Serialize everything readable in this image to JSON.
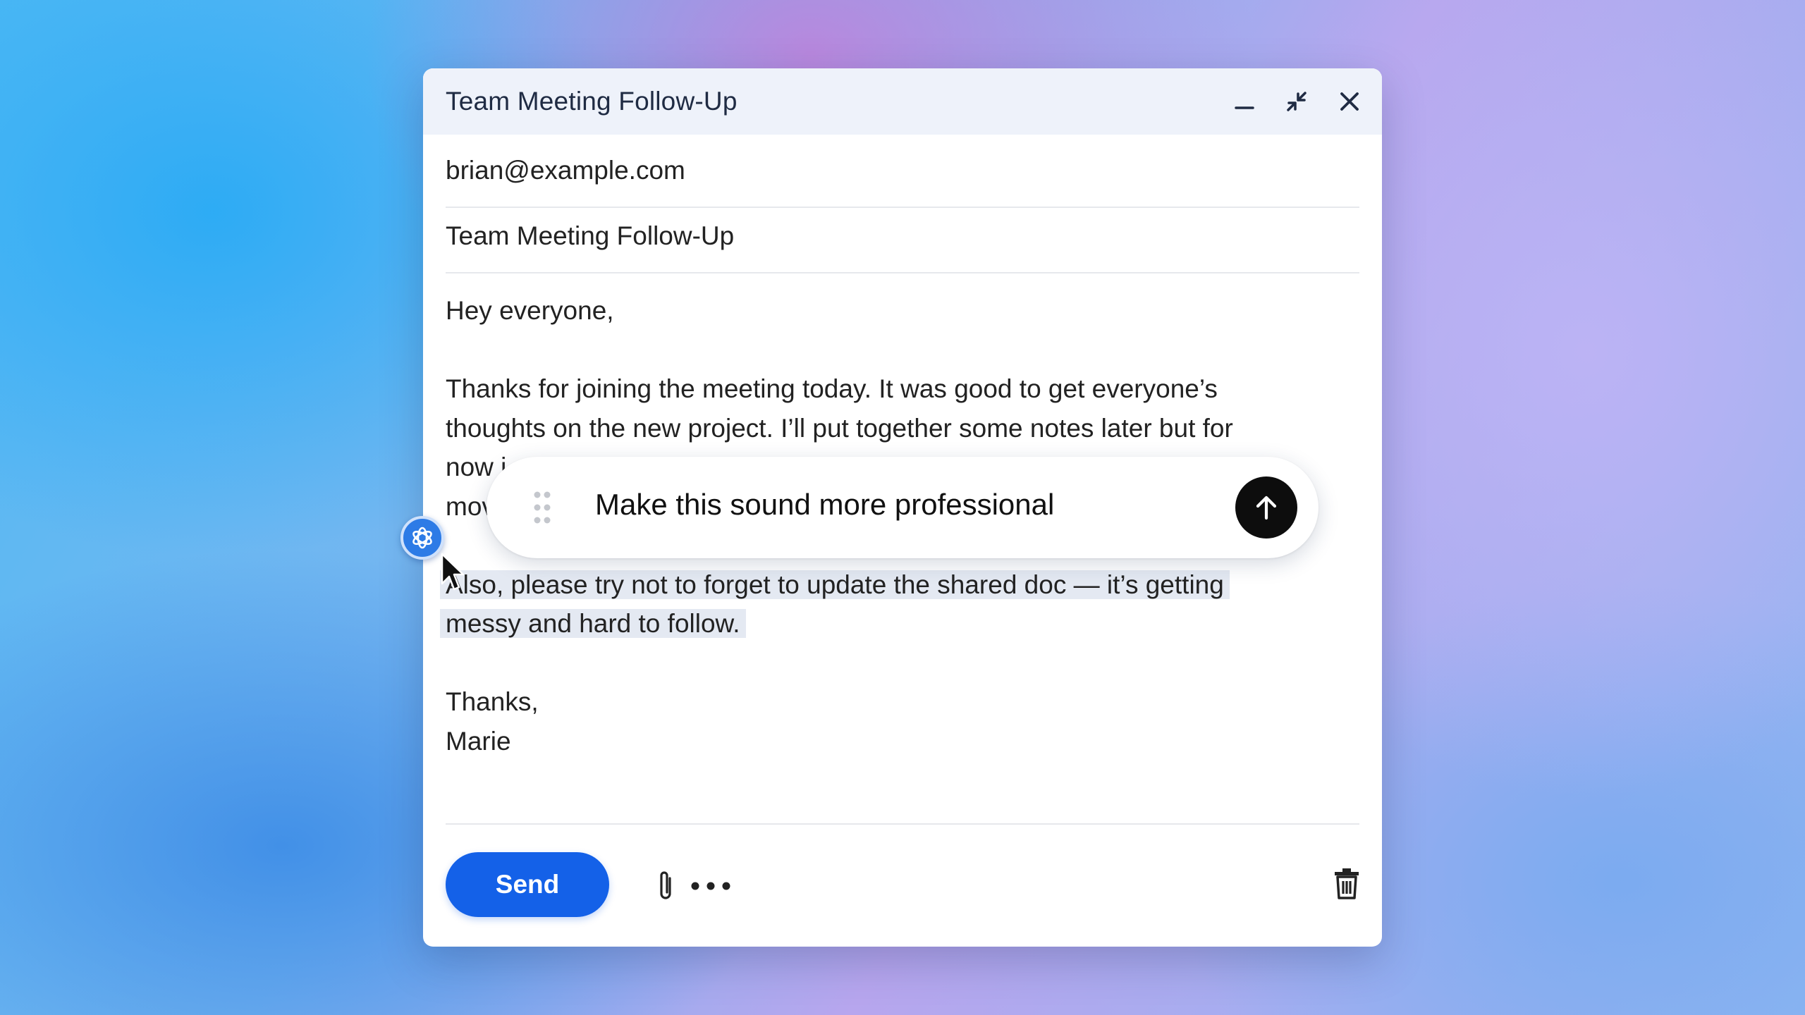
{
  "compose": {
    "title": "Team Meeting Follow-Up",
    "to": "brian@example.com",
    "subject": "Team Meeting Follow-Up",
    "body": {
      "greeting": "Hey everyone,",
      "p1_line1": "Thanks for joining the meeting today. It was good to get everyone’s",
      "p1_line2": "thoughts on the new project. I’ll put together some notes later but for",
      "p1_line3": "now i",
      "p1_line4": "mov",
      "p2_line1": "Also, please try not to forget to update the shared doc — it’s getting",
      "p2_line2": "messy and hard to follow.",
      "signoff": "Thanks,",
      "signature": "Marie"
    },
    "send_label": "Send"
  },
  "window_controls": [
    "minimize-icon",
    "shrink-icon",
    "close-icon"
  ],
  "toolbar_icons": [
    "paperclip-icon",
    "more-icon",
    "trash-icon"
  ],
  "ai_prompt": {
    "text": "Make this sound more professional",
    "submit_icon": "arrow-up-icon",
    "handle_icon": "drag-handle-icon"
  },
  "colors": {
    "send": "#1461e8",
    "titlebar": "#eef2fa",
    "highlight": "#e4e9f2",
    "submit": "#0d0d0d",
    "ai_badge": "#2d7be6"
  }
}
